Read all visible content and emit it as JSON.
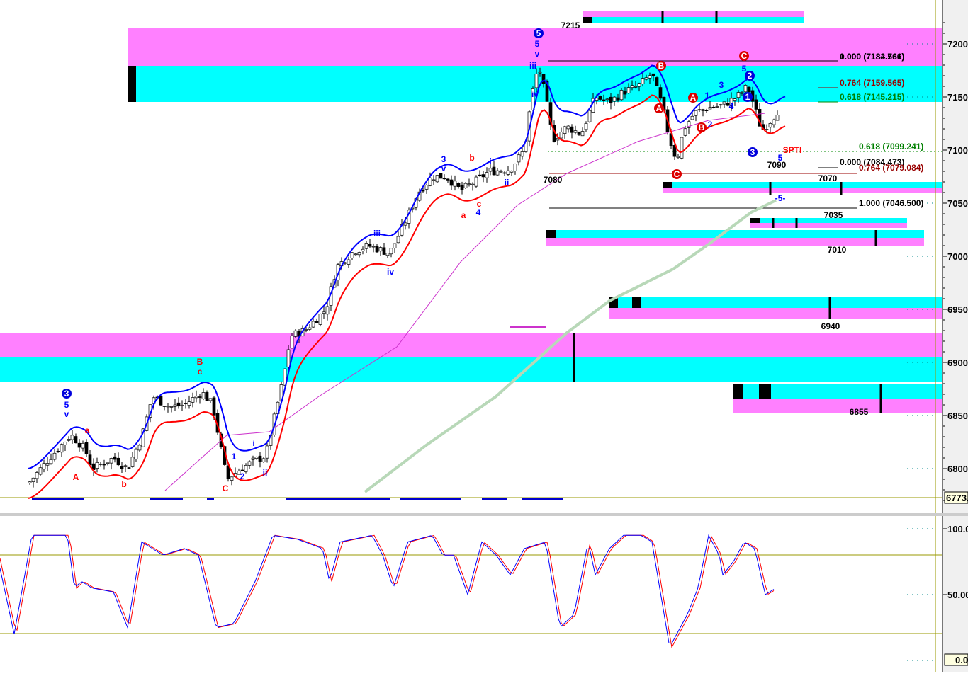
{
  "chart_data": {
    "type": "candlestick",
    "instrument_panel": {
      "y_ticks": [
        7200,
        7150,
        7100,
        7050,
        7000,
        6950,
        6900,
        6850,
        6800
      ],
      "y_tick_labels": [
        "7200",
        "7150",
        "7100",
        "7050",
        "7000",
        "6950",
        "6900",
        "6850",
        "6800"
      ],
      "last_price_label": "6773.",
      "price_path": [
        [
          45,
          6790
        ],
        [
          70,
          6810
        ],
        [
          100,
          6832
        ],
        [
          120,
          6818
        ],
        [
          130,
          6800
        ],
        [
          160,
          6810
        ],
        [
          180,
          6800
        ],
        [
          200,
          6830
        ],
        [
          215,
          6868
        ],
        [
          240,
          6858
        ],
        [
          260,
          6860
        ],
        [
          285,
          6872
        ],
        [
          300,
          6860
        ],
        [
          320,
          6790
        ],
        [
          340,
          6800
        ],
        [
          360,
          6808
        ],
        [
          375,
          6812
        ],
        [
          385,
          6842
        ],
        [
          400,
          6885
        ],
        [
          410,
          6925
        ],
        [
          430,
          6930
        ],
        [
          460,
          6950
        ],
        [
          475,
          6990
        ],
        [
          500,
          7005
        ],
        [
          520,
          7010
        ],
        [
          550,
          7003
        ],
        [
          570,
          7030
        ],
        [
          590,
          7060
        ],
        [
          610,
          7075
        ],
        [
          630,
          7075
        ],
        [
          650,
          7062
        ],
        [
          670,
          7070
        ],
        [
          690,
          7080
        ],
        [
          720,
          7082
        ],
        [
          740,
          7100
        ],
        [
          750,
          7150
        ],
        [
          760,
          7180
        ],
        [
          770,
          7150
        ],
        [
          780,
          7110
        ],
        [
          800,
          7122
        ],
        [
          820,
          7115
        ],
        [
          840,
          7150
        ],
        [
          860,
          7145
        ],
        [
          880,
          7155
        ],
        [
          900,
          7160
        ],
        [
          920,
          7172
        ],
        [
          935,
          7140
        ],
        [
          945,
          7110
        ],
        [
          955,
          7090
        ],
        [
          965,
          7120
        ],
        [
          980,
          7135
        ],
        [
          1000,
          7140
        ],
        [
          1020,
          7142
        ],
        [
          1040,
          7150
        ],
        [
          1055,
          7160
        ],
        [
          1065,
          7140
        ],
        [
          1075,
          7118
        ],
        [
          1090,
          7130
        ],
        [
          1100,
          7140
        ]
      ]
    },
    "oscillator_panel": {
      "y_tick_labels": [
        "100.0",
        "50.00",
        "0.0"
      ],
      "path": [
        [
          0,
          70
        ],
        [
          20,
          20
        ],
        [
          45,
          95
        ],
        [
          95,
          95
        ],
        [
          105,
          55
        ],
        [
          115,
          60
        ],
        [
          130,
          55
        ],
        [
          160,
          52
        ],
        [
          180,
          25
        ],
        [
          200,
          90
        ],
        [
          230,
          80
        ],
        [
          260,
          85
        ],
        [
          280,
          80
        ],
        [
          305,
          25
        ],
        [
          330,
          28
        ],
        [
          360,
          60
        ],
        [
          385,
          95
        ],
        [
          420,
          92
        ],
        [
          455,
          85
        ],
        [
          465,
          60
        ],
        [
          480,
          90
        ],
        [
          525,
          95
        ],
        [
          540,
          80
        ],
        [
          555,
          55
        ],
        [
          575,
          90
        ],
        [
          610,
          95
        ],
        [
          625,
          80
        ],
        [
          640,
          80
        ],
        [
          660,
          50
        ],
        [
          680,
          90
        ],
        [
          700,
          80
        ],
        [
          720,
          65
        ],
        [
          740,
          85
        ],
        [
          770,
          90
        ],
        [
          790,
          25
        ],
        [
          810,
          35
        ],
        [
          830,
          90
        ],
        [
          840,
          65
        ],
        [
          860,
          85
        ],
        [
          880,
          95
        ],
        [
          905,
          95
        ],
        [
          920,
          90
        ],
        [
          945,
          10
        ],
        [
          970,
          35
        ],
        [
          985,
          55
        ],
        [
          1000,
          95
        ],
        [
          1015,
          80
        ],
        [
          1020,
          65
        ],
        [
          1035,
          75
        ],
        [
          1050,
          90
        ],
        [
          1065,
          85
        ],
        [
          1080,
          50
        ],
        [
          1095,
          55
        ]
      ]
    },
    "fib_labels": [
      {
        "text": "0.000 (7184.566)",
        "color": "#000000"
      },
      {
        "text": "1.000 (7182.761)",
        "color": "#000000"
      },
      {
        "text": "0.764 (7159.565)",
        "color": "#990000"
      },
      {
        "text": "0.618 (7145.215)",
        "color": "#008000"
      },
      {
        "text": "0.618 (7099.241)",
        "color": "#008000"
      },
      {
        "text": "0.000 (7084.473)",
        "color": "#000000"
      },
      {
        "text": "0.764 (7079.084)",
        "color": "#990000"
      },
      {
        "text": "1.000 (7046.500)",
        "color": "#000000"
      }
    ],
    "level_labels": [
      "7215",
      "7080",
      "7070",
      "7035",
      "7010",
      "6940",
      "6855",
      "7090"
    ],
    "wave_labels_blue": [
      "5",
      "v",
      "5",
      "v",
      "iii",
      "iv",
      "3",
      "v",
      "i",
      "ii",
      "iii",
      "iv",
      "1",
      "2",
      "i",
      "ii",
      "4",
      "1",
      "2",
      "3",
      "4",
      "5",
      "5",
      "-5-"
    ],
    "wave_labels_red": [
      "A",
      "b",
      "B",
      "c",
      "C",
      "a",
      "a",
      "b",
      "c",
      "SPTI"
    ],
    "circled_blue": [
      "3",
      "5",
      "2",
      "1",
      "3"
    ],
    "circled_red": [
      "B",
      "A",
      "A",
      "B",
      "C",
      "C"
    ]
  },
  "colors": {
    "pink": "#ff80ff",
    "cyan": "#00ffff",
    "blue": "#0000ff",
    "red": "#ff0000",
    "magenta": "#cc33cc",
    "green": "#b8d8b8",
    "olive": "#999900"
  }
}
